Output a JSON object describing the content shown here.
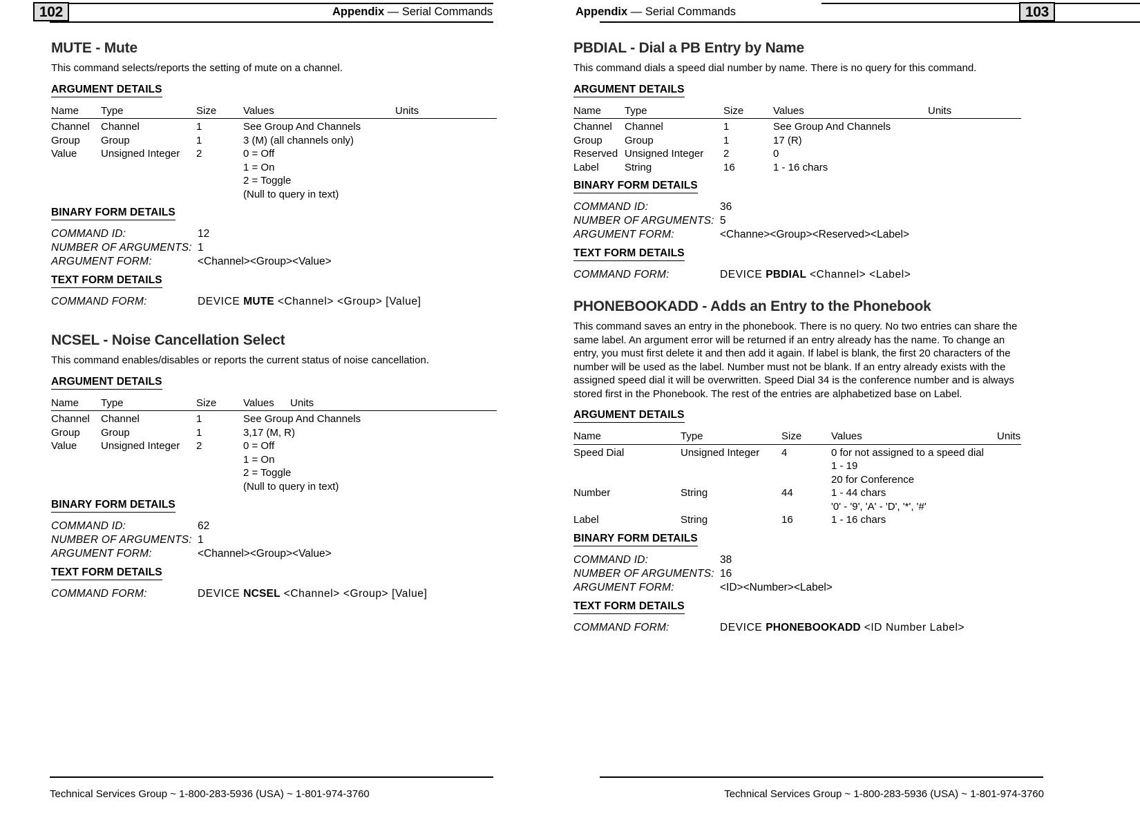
{
  "left_page": {
    "page_number": "102",
    "running_head_prefix": "Appendix",
    "running_head_dash": "—",
    "running_head_suffix": "Serial Commands",
    "footer": "Technical Services Group ~ 1-800-283-5936 (USA) ~ 1-801-974-3760",
    "commands": [
      {
        "title": "MUTE - Mute",
        "description": "This command selects/reports the setting of mute on a channel.",
        "argument_details_heading": "ARGUMENT DETAILS",
        "table": {
          "headers": [
            "Name",
            "Type",
            "Size",
            "Values",
            "Units"
          ],
          "rows": [
            {
              "name": "Channel",
              "type": "Channel",
              "size": "1",
              "values": [
                "See Group And Channels"
              ],
              "units": ""
            },
            {
              "name": "Group",
              "type": "Group",
              "size": "1",
              "values": [
                "3 (M) (all channels only)"
              ],
              "units": ""
            },
            {
              "name": "Value",
              "type": "Unsigned Integer",
              "size": "2",
              "values": [
                "0 = Off",
                "1 = On",
                "2 = Toggle",
                "(Null to query in text)"
              ],
              "units": ""
            }
          ]
        },
        "binary_form_heading": "BINARY FORM DETAILS",
        "binary_form": [
          {
            "label": "COMMAND ID:",
            "value": "12"
          },
          {
            "label": "NUMBER OF ARGUMENTS:",
            "value": "1"
          },
          {
            "label": "ARGUMENT FORM:",
            "value": "<Channel><Group><Value>"
          }
        ],
        "text_form_heading": "TEXT FORM DETAILS",
        "text_form": {
          "label": "COMMAND FORM:",
          "prefix": "DEVICE ",
          "keyword": "MUTE",
          "suffix": " <Channel> <Group> [Value]"
        }
      },
      {
        "title": "NCSEL - Noise Cancellation Select",
        "description": "This command enables/disables or reports the current status of noise cancellation.",
        "argument_details_heading": "ARGUMENT DETAILS",
        "table": {
          "headers": [
            "Name",
            "Type",
            "Size",
            "Values",
            "Units"
          ],
          "rows": [
            {
              "name": "Channel",
              "type": "Channel",
              "size": "1",
              "values": [
                "See Group And Channels"
              ],
              "units": ""
            },
            {
              "name": "Group",
              "type": "Group",
              "size": "1",
              "values": [
                "3,17 (M, R)"
              ],
              "units": ""
            },
            {
              "name": "Value",
              "type": "Unsigned Integer",
              "size": "2",
              "values": [
                "0 = Off",
                "1 = On",
                "2 = Toggle",
                "(Null to query in text)"
              ],
              "units": ""
            }
          ]
        },
        "binary_form_heading": "BINARY FORM DETAILS",
        "binary_form": [
          {
            "label": "COMMAND ID:",
            "value": "62"
          },
          {
            "label": "NUMBER OF ARGUMENTS:",
            "value": "1"
          },
          {
            "label": "ARGUMENT FORM:",
            "value": "<Channel><Group><Value>"
          }
        ],
        "text_form_heading": "TEXT FORM DETAILS",
        "text_form": {
          "label": "COMMAND FORM:",
          "prefix": "DEVICE ",
          "keyword": "NCSEL",
          "suffix": " <Channel> <Group> [Value]"
        }
      }
    ]
  },
  "right_page": {
    "page_number": "103",
    "running_head_prefix": "Appendix",
    "running_head_dash": "—",
    "running_head_suffix": "Serial Commands",
    "footer": "Technical Services Group ~ 1-800-283-5936 (USA) ~ 1-801-974-3760",
    "commands": [
      {
        "title": "PBDIAL - Dial a PB Entry by Name",
        "description": "This command dials a speed dial number by name. There is no query for this command.",
        "argument_details_heading": "ARGUMENT DETAILS",
        "table": {
          "headers": [
            "Name",
            "Type",
            "Size",
            "Values",
            "Units"
          ],
          "rows": [
            {
              "name": "Channel",
              "type": "Channel",
              "size": "1",
              "values": [
                "See Group And Channels"
              ],
              "units": ""
            },
            {
              "name": "Group",
              "type": "Group",
              "size": "1",
              "values": [
                "17 (R)"
              ],
              "units": ""
            },
            {
              "name": "Reserved",
              "type": "Unsigned Integer",
              "size": "2",
              "values": [
                "0"
              ],
              "units": ""
            },
            {
              "name": "Label",
              "type": "String",
              "size": "16",
              "values": [
                "1 - 16 chars"
              ],
              "units": ""
            }
          ]
        },
        "binary_form_heading": "BINARY FORM DETAILS",
        "binary_form": [
          {
            "label": "COMMAND ID:",
            "value": "36"
          },
          {
            "label": "NUMBER OF ARGUMENTS:",
            "value": "5"
          },
          {
            "label": "ARGUMENT FORM:",
            "value": "<Channe><Group><Reserved><Label>"
          }
        ],
        "text_form_heading": "TEXT FORM DETAILS",
        "text_form": {
          "label": "COMMAND FORM:",
          "prefix": "DEVICE ",
          "keyword": "PBDIAL",
          "suffix": " <Channel> <Label>"
        }
      },
      {
        "title": "PHONEBOOKADD - Adds an Entry to the Phonebook",
        "description": "This command saves an entry in the phonebook. There is no query. No two entries can share the same label.  An argument error will be returned if an entry already has the name.  To change an entry, you must first delete it and then add it again. If label is blank, the first 20 characters of the number will be used as the label. Number must not be blank. If an entry already exists with the assigned speed dial it will be overwritten. Speed Dial 34 is the conference number and is always stored first in the Phonebook. The rest of the entries are alphabetized base on Label.",
        "argument_details_heading": "ARGUMENT DETAILS",
        "table": {
          "headers": [
            "Name",
            "Type",
            "Size",
            "Values",
            "Units"
          ],
          "rows": [
            {
              "name": "Speed Dial",
              "type": "Unsigned Integer",
              "size": "4",
              "values": [
                "0 for not assigned to a speed dial",
                "1 - 19",
                "20 for Conference"
              ],
              "units": ""
            },
            {
              "name": "Number",
              "type": "String",
              "size": "44",
              "values": [
                "1 - 44 chars",
                "'0' - '9', 'A' - 'D', '*', '#'"
              ],
              "units": ""
            },
            {
              "name": "Label",
              "type": "String",
              "size": "16",
              "values": [
                "1 - 16 chars"
              ],
              "units": ""
            }
          ]
        },
        "binary_form_heading": "BINARY FORM DETAILS",
        "binary_form": [
          {
            "label": "COMMAND ID:",
            "value": "38"
          },
          {
            "label": "NUMBER OF ARGUMENTS:",
            "value": "16"
          },
          {
            "label": "ARGUMENT FORM:",
            "value": "<ID><Number><Label>"
          }
        ],
        "text_form_heading": "TEXT FORM DETAILS",
        "text_form": {
          "label": "COMMAND FORM:",
          "prefix": "DEVICE ",
          "keyword": "PHONEBOOKADD",
          "suffix": " <ID Number Label>"
        }
      }
    ]
  }
}
